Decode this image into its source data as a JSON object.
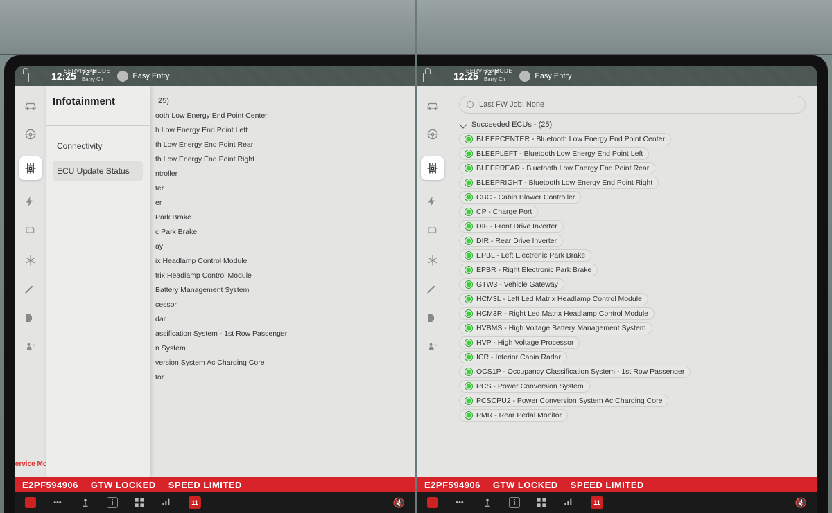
{
  "status": {
    "service_mode": "SERVICE MODE",
    "time": "12:25",
    "temp": "72°F",
    "street": "Barry Cir",
    "profile": "Easy Entry"
  },
  "left": {
    "drawer": {
      "title": "Infotainment",
      "items": [
        {
          "label": "Connectivity",
          "selected": false
        },
        {
          "label": "ECU Update Status",
          "selected": true
        }
      ]
    },
    "group_header_fragment": "25)",
    "ecu_fragments": [
      "ooth Low Energy End Point Center",
      "h Low Energy End Point Left",
      "th Low Energy End Point Rear",
      "th Low Energy End Point Right",
      "ntroller",
      "ter",
      "er",
      "Park Brake",
      "c Park Brake",
      "ay",
      "ix Headlamp Control Module",
      "trix Headlamp Control Module",
      "Battery Management System",
      "cessor",
      "dar",
      "assification System - 1st Row Passenger",
      "n System",
      "version System Ac Charging Core",
      "tor"
    ],
    "exit_label": "Exit Service Mode"
  },
  "right": {
    "fw_job": "Last FW Job: None",
    "group_header": "Succeeded ECUs - (25)",
    "ecus": [
      "BLEEPCENTER - Bluetooth Low Energy End Point Center",
      "BLEEPLEFT - Bluetooth Low Energy End Point Left",
      "BLEEPREAR - Bluetooth Low Energy End Point Rear",
      "BLEEPRIGHT - Bluetooth Low Energy End Point Right",
      "CBC - Cabin Blower Controller",
      "CP - Charge Port",
      "DIF - Front Drive Inverter",
      "DIR - Rear Drive Inverter",
      "EPBL - Left Electronic Park Brake",
      "EPBR - Right Electronic Park Brake",
      "GTW3 - Vehicle Gateway",
      "HCM3L - Left Led Matrix Headlamp Control Module",
      "HCM3R - Right Led Matrix Headlamp Control Module",
      "HVBMS - High Voltage Battery Management System",
      "HVP - High Voltage Processor",
      "ICR - Interior Cabin Radar",
      "OCS1P - Occupancy Classification System - 1st Row Passenger",
      "PCS - Power Conversion System",
      "PCSCPU2 - Power Conversion System Ac Charging Core",
      "PMR - Rear Pedal Monitor"
    ]
  },
  "banner": {
    "vin_fragment": "E2PF594906",
    "gtw": "GTW LOCKED",
    "speed": "SPEED LIMITED"
  },
  "bottom": {
    "cal_day": "11"
  }
}
